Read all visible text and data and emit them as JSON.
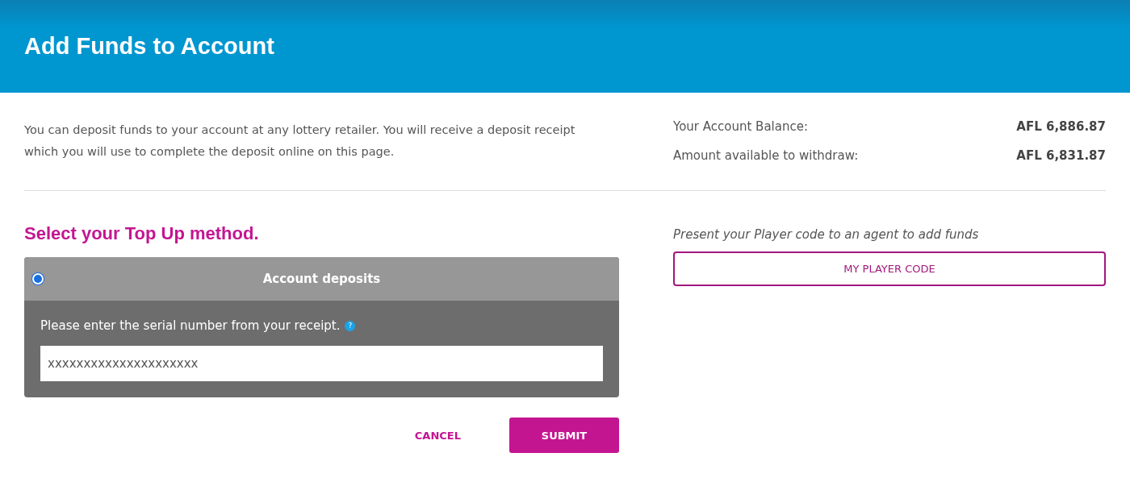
{
  "header": {
    "title": "Add Funds to Account"
  },
  "intro": "You can deposit funds to your account at any lottery retailer. You will receive a deposit receipt which you will use to complete the deposit online on this page.",
  "balances": [
    {
      "label": "Your Account Balance:",
      "value": "AFL 6,886.87"
    },
    {
      "label": "Amount available to withdraw:",
      "value": "AFL 6,831.87"
    }
  ],
  "method": {
    "heading": "Select your Top Up method.",
    "options": [
      {
        "label": "Account deposits",
        "selected": true,
        "prompt": "Please enter the serial number from your receipt.",
        "help": "?",
        "field": {
          "placeholder": "xxxxxxxxxxxxxxxxxxxxx"
        }
      }
    ],
    "buttons": [
      {
        "label": "CANCEL",
        "kind": "text"
      },
      {
        "label": "SUBMIT",
        "kind": "primary"
      }
    ]
  },
  "player_code": {
    "note": "Present your Player code to an agent to add funds",
    "button": "MY PLAYER CODE"
  }
}
